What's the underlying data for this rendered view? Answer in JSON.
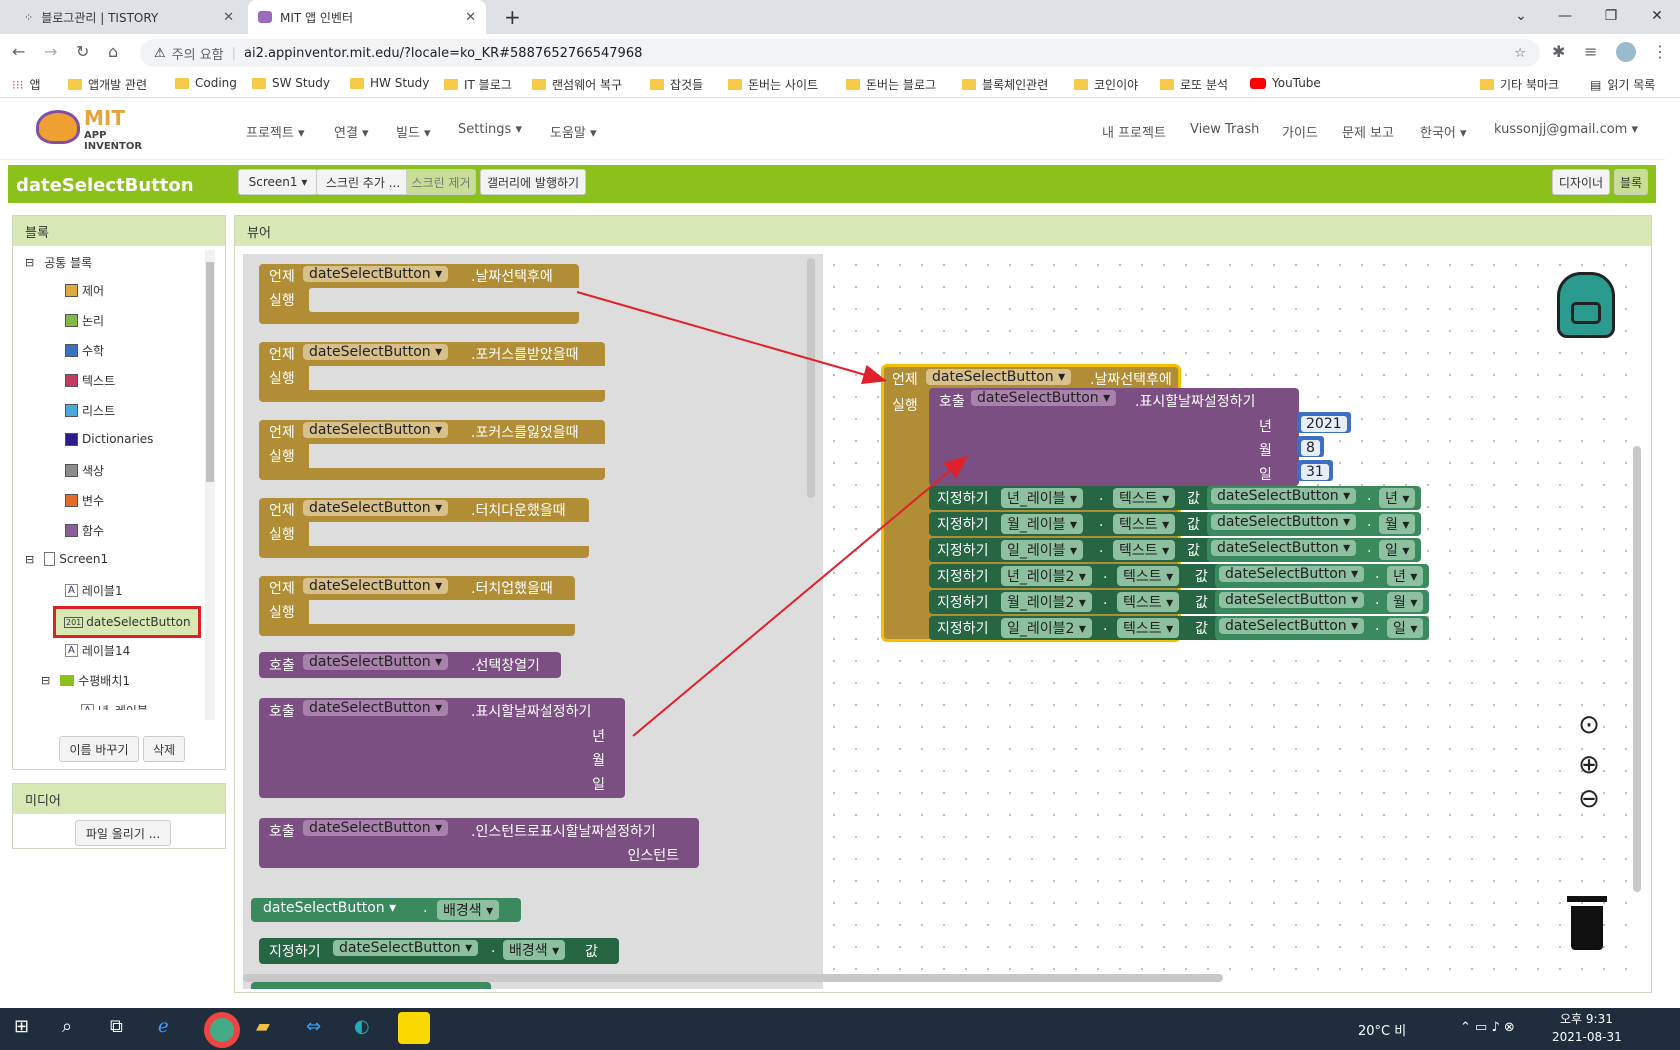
{
  "browser": {
    "tabs": [
      {
        "title": "블로그관리 | TISTORY",
        "close": "✕"
      },
      {
        "title": "MIT 앱 인벤터",
        "close": "✕"
      }
    ],
    "new_tab": "+",
    "security": "주의 요함",
    "url": "ai2.appinventor.mit.edu/?locale=ko_KR#5887652766547968",
    "bookmarks": [
      "앱",
      "앱개발 관련",
      "Coding",
      "SW Study",
      "HW Study",
      "IT 블로그",
      "랜섬웨어 복구",
      "잡것들",
      "돈버는 사이트",
      "돈버는 블로그",
      "블록체인관련",
      "코인이야",
      "로또 분석",
      "YouTube"
    ],
    "bookmarks_right": [
      "기타 북마크",
      "읽기 목록"
    ]
  },
  "app": {
    "logo_mit": "MIT",
    "logo_sub": "APP INVENTOR",
    "menus": [
      "프로젝트 ▾",
      "연결 ▾",
      "빌드 ▾",
      "Settings ▾",
      "도움말 ▾"
    ],
    "right_menus": [
      "내 프로젝트",
      "View Trash",
      "가이드",
      "문제 보고",
      "한국어 ▾",
      "kussonjj@gmail.com ▾"
    ],
    "component_title": "dateSelectButton",
    "screen_btn": "Screen1 ▾",
    "add_screen": "스크린 추가 ...",
    "remove_screen": "스크린 제거",
    "publish": "갤러리에 발행하기",
    "designer": "디자이너",
    "blocks_btn": "블록"
  },
  "blocks_panel": {
    "title": "블록",
    "builtin": "공통 블록",
    "categories": [
      {
        "label": "제어",
        "color": "#e1a93c"
      },
      {
        "label": "논리",
        "color": "#84b94a"
      },
      {
        "label": "수학",
        "color": "#3b73c4"
      },
      {
        "label": "텍스트",
        "color": "#c33a62"
      },
      {
        "label": "리스트",
        "color": "#4aa8da"
      },
      {
        "label": "Dictionaries",
        "color": "#2d1a8c"
      },
      {
        "label": "색상",
        "color": "#8c8c8c"
      },
      {
        "label": "변수",
        "color": "#e56b2d"
      },
      {
        "label": "함수",
        "color": "#8b5e99"
      }
    ],
    "screen": "Screen1",
    "components": [
      "레이블1",
      "dateSelectButton",
      "레이블14",
      "수평배치1",
      "년_레이블"
    ],
    "rename": "이름 바꾸기",
    "delete": "삭제"
  },
  "media_panel": {
    "title": "미디어",
    "upload": "파일 올리기 ..."
  },
  "viewer": {
    "title": "뷰어",
    "flyout": {
      "when": "언제",
      "do": "실행",
      "call": "호출",
      "set": "지정하기",
      "to": "값",
      "component": "dateSelectButton",
      "events": [
        ".날짜선택후에",
        ".포커스를받았을때",
        ".포커스를잃었을때",
        ".터치다운했을때",
        ".터치업했을때"
      ],
      "method_open": ".선택창열기",
      "method_set": ".표시할날짜설정하기",
      "param_year": "년",
      "param_month": "월",
      "param_day": "일",
      "method_instant": ".인스턴트로표시할날짜설정하기",
      "param_instant": "인스턴트",
      "prop_bg": "배경색",
      "dot": "."
    },
    "workspace": {
      "event": ".날짜선택후에",
      "year_value": "2021",
      "month_value": "8",
      "day_value": "31",
      "prop_text": "텍스트",
      "labels": [
        "년_레이블",
        "월_레이블",
        "일_레이블",
        "년_레이블2",
        "월_레이블2",
        "일_레이블2"
      ],
      "getters": [
        "년",
        "월",
        "일",
        "년",
        "월",
        "일"
      ]
    }
  },
  "taskbar": {
    "weather": "20°C 비",
    "time": "오후 9:31",
    "date": "2021-08-31"
  },
  "colors": {
    "green": "#8bc11a",
    "event": "#b18e35",
    "proc": "#7b4f82",
    "setter": "#266643",
    "arrow": "#e0202a"
  }
}
